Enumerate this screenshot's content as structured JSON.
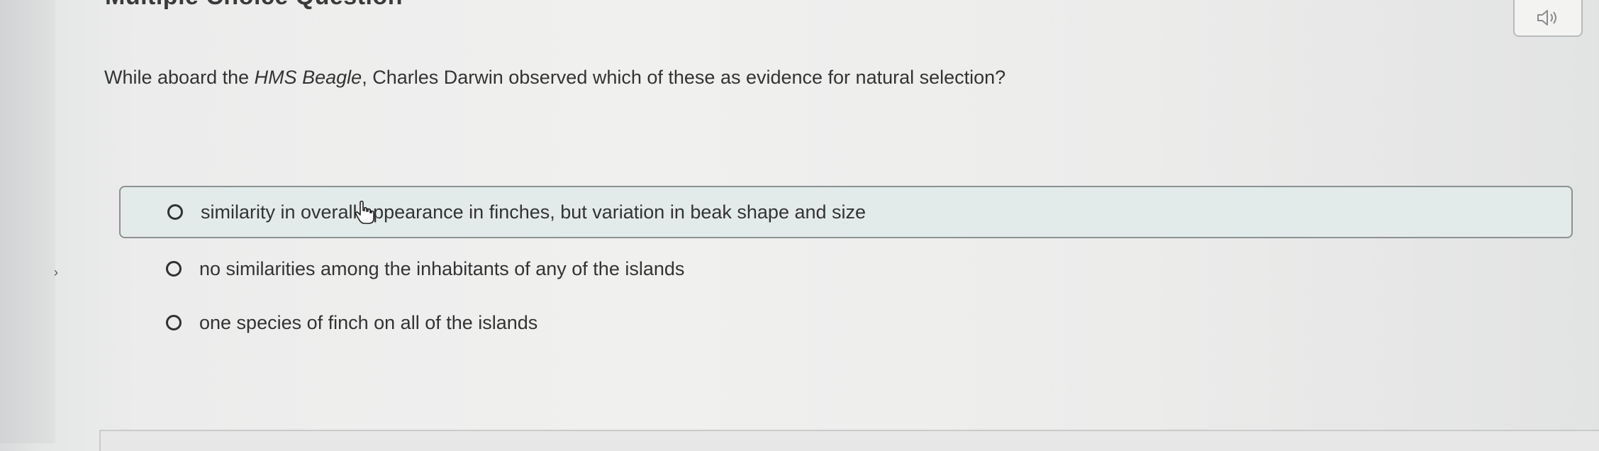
{
  "page": {
    "title": "Multiple Choice Question"
  },
  "audio": {
    "icon": "speaker-icon"
  },
  "question": {
    "prefix": "While aboard the ",
    "ship": "HMS Beagle",
    "suffix": ", Charles Darwin observed which of these as evidence for natural selection?"
  },
  "options": [
    {
      "label": "similarity in overall appearance in finches, but variation in beak shape and size",
      "selected": true
    },
    {
      "label": "no similarities among the inhabitants of any of the islands",
      "selected": false
    },
    {
      "label": "one species of finch on all of the islands",
      "selected": false
    }
  ],
  "colors": {
    "selected_background": "#e3ebea",
    "selected_border": "#8c9191",
    "text": "#333333"
  }
}
